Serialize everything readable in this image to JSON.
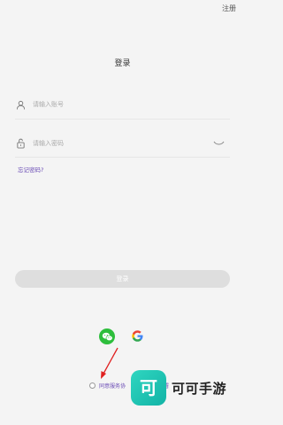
{
  "header": {
    "register_label": "注册"
  },
  "page_title": "登录",
  "account_field": {
    "placeholder": "请输入账号",
    "value": ""
  },
  "password_field": {
    "placeholder": "请输入密码",
    "value": ""
  },
  "forgot_password_label": "忘记密码?",
  "login_button_label": "登录",
  "social_login": [
    {
      "name": "wechat",
      "icon": "wechat-icon",
      "color": "#2dbe3c"
    },
    {
      "name": "google",
      "icon": "google-icon"
    }
  ],
  "agreement": {
    "checked": false,
    "text_visible": "同意服务协",
    "text_tail": "署"
  },
  "watermark": {
    "logo_glyph": "可",
    "text": "可可手游"
  },
  "colors": {
    "background": "#f4f4f4",
    "link_purple": "#6a4bb5",
    "disabled_button": "#dedede",
    "annotation_arrow": "#e02020",
    "watermark_teal": "#1fc4b3"
  }
}
